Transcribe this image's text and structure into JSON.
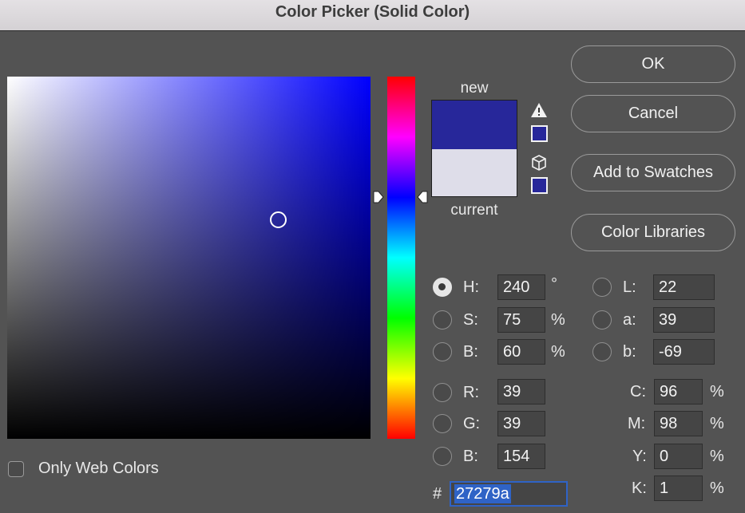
{
  "window": {
    "title": "Color Picker (Solid Color)"
  },
  "colors": {
    "new": "#27279a",
    "current": "#dedde9",
    "hue_base": "#0000ff",
    "background": "#535353",
    "hex_highlight": "#2f63c6"
  },
  "preview": {
    "new_label": "new",
    "current_label": "current"
  },
  "icons": {
    "gamut_warning": "warning-triangle-icon",
    "web_safe": "cube-icon",
    "hue_marker": "slider-arrow-icon"
  },
  "buttons": {
    "ok": "OK",
    "cancel": "Cancel",
    "add_to_swatches": "Add to Swatches",
    "color_libraries": "Color Libraries"
  },
  "hsb": {
    "selected": "H",
    "h": {
      "label": "H:",
      "value": "240",
      "unit": "°"
    },
    "s": {
      "label": "S:",
      "value": "75",
      "unit": "%"
    },
    "b": {
      "label": "B:",
      "value": "60",
      "unit": "%"
    }
  },
  "rgb": {
    "r": {
      "label": "R:",
      "value": "39"
    },
    "g": {
      "label": "G:",
      "value": "39"
    },
    "b": {
      "label": "B:",
      "value": "154"
    }
  },
  "lab": {
    "l": {
      "label": "L:",
      "value": "22"
    },
    "a": {
      "label": "a:",
      "value": "39"
    },
    "b": {
      "label": "b:",
      "value": "-69"
    }
  },
  "cmyk": {
    "c": {
      "label": "C:",
      "value": "96",
      "unit": "%"
    },
    "m": {
      "label": "M:",
      "value": "98",
      "unit": "%"
    },
    "y": {
      "label": "Y:",
      "value": "0",
      "unit": "%"
    },
    "k": {
      "label": "K:",
      "value": "1",
      "unit": "%"
    }
  },
  "hex": {
    "label": "#",
    "value": "27279a"
  },
  "options": {
    "only_web_colors_label": "Only Web Colors",
    "only_web_colors_checked": false
  }
}
